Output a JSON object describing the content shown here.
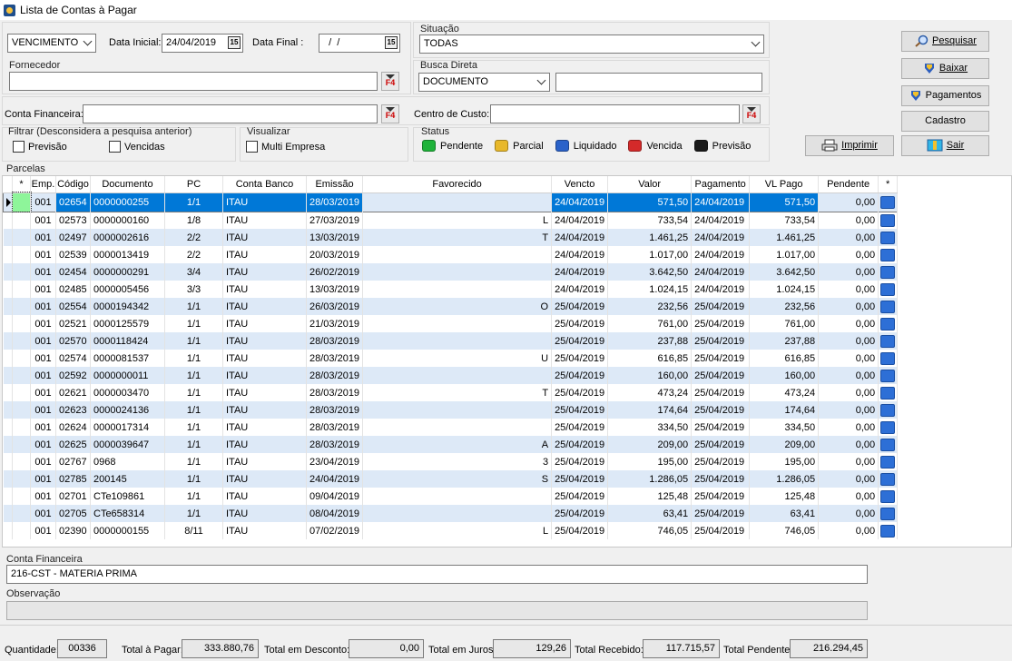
{
  "window": {
    "title": "Lista de Contas à Pagar"
  },
  "filters": {
    "date_type": "VENCIMENTO",
    "data_inicial_label": "Data Inicial:",
    "data_inicial": "24/04/2019",
    "data_final_label": "Data Final :",
    "data_final": "  /  /",
    "situacao_label": "Situação",
    "situacao": "TODAS",
    "fornecedor_label": "Fornecedor",
    "fornecedor": "",
    "busca_label": "Busca Direta",
    "busca_tipo": "DOCUMENTO",
    "busca_valor": "",
    "conta_financeira_label": "Conta Financeira:",
    "conta_financeira": "",
    "centro_custo_label": "Centro de Custo:",
    "centro_custo": "",
    "f4": "F4",
    "cal": "15",
    "filtrar_label": "Filtrar (Desconsidera a pesquisa anterior)",
    "previsao": "Previsão",
    "vencidas": "Vencidas",
    "visualizar_label": "Visualizar",
    "multi_empresa": "Multi Empresa"
  },
  "status": {
    "label": "Status",
    "items": [
      {
        "name": "Pendente",
        "color": "#1fb33a"
      },
      {
        "name": "Parcial",
        "color": "#e8b82a"
      },
      {
        "name": "Liquidado",
        "color": "#2a62c9"
      },
      {
        "name": "Vencida",
        "color": "#d42a2a"
      },
      {
        "name": "Previsão",
        "color": "#1a1a1a"
      }
    ]
  },
  "buttons": {
    "pesquisar": "Pesquisar",
    "baixar": "Baixar",
    "pagamentos": "Pagamentos",
    "cadastro": "Cadastro",
    "imprimir": "Imprimir",
    "sair": "Sair"
  },
  "grid": {
    "label": "Parcelas",
    "columns": [
      "*",
      "Emp.",
      "Código",
      "Documento",
      "PC",
      "Conta Banco",
      "Emissão",
      "Favorecido",
      "Vencto",
      "Valor",
      "Pagamento",
      "VL Pago",
      "Pendente",
      "*"
    ],
    "rows": [
      {
        "emp": "001",
        "cod": "02654",
        "doc": "0000000255",
        "pc": "1/1",
        "banco": "ITAU",
        "emissao": "28/03/2019",
        "fav": "",
        "vencto": "24/04/2019",
        "valor": "571,50",
        "pag": "24/04/2019",
        "vlpago": "571,50",
        "pend": "0,00"
      },
      {
        "emp": "001",
        "cod": "02573",
        "doc": "0000000160",
        "pc": "1/8",
        "banco": "ITAU",
        "emissao": "27/03/2019",
        "fav": "L",
        "vencto": "24/04/2019",
        "valor": "733,54",
        "pag": "24/04/2019",
        "vlpago": "733,54",
        "pend": "0,00"
      },
      {
        "emp": "001",
        "cod": "02497",
        "doc": "0000002616",
        "pc": "2/2",
        "banco": "ITAU",
        "emissao": "13/03/2019",
        "fav": "T",
        "vencto": "24/04/2019",
        "valor": "1.461,25",
        "pag": "24/04/2019",
        "vlpago": "1.461,25",
        "pend": "0,00"
      },
      {
        "emp": "001",
        "cod": "02539",
        "doc": "0000013419",
        "pc": "2/2",
        "banco": "ITAU",
        "emissao": "20/03/2019",
        "fav": "",
        "vencto": "24/04/2019",
        "valor": "1.017,00",
        "pag": "24/04/2019",
        "vlpago": "1.017,00",
        "pend": "0,00"
      },
      {
        "emp": "001",
        "cod": "02454",
        "doc": "0000000291",
        "pc": "3/4",
        "banco": "ITAU",
        "emissao": "26/02/2019",
        "fav": "",
        "vencto": "24/04/2019",
        "valor": "3.642,50",
        "pag": "24/04/2019",
        "vlpago": "3.642,50",
        "pend": "0,00"
      },
      {
        "emp": "001",
        "cod": "02485",
        "doc": "0000005456",
        "pc": "3/3",
        "banco": "ITAU",
        "emissao": "13/03/2019",
        "fav": "",
        "vencto": "24/04/2019",
        "valor": "1.024,15",
        "pag": "24/04/2019",
        "vlpago": "1.024,15",
        "pend": "0,00"
      },
      {
        "emp": "001",
        "cod": "02554",
        "doc": "0000194342",
        "pc": "1/1",
        "banco": "ITAU",
        "emissao": "26/03/2019",
        "fav": "O",
        "vencto": "25/04/2019",
        "valor": "232,56",
        "pag": "25/04/2019",
        "vlpago": "232,56",
        "pend": "0,00"
      },
      {
        "emp": "001",
        "cod": "02521",
        "doc": "0000125579",
        "pc": "1/1",
        "banco": "ITAU",
        "emissao": "21/03/2019",
        "fav": "",
        "vencto": "25/04/2019",
        "valor": "761,00",
        "pag": "25/04/2019",
        "vlpago": "761,00",
        "pend": "0,00"
      },
      {
        "emp": "001",
        "cod": "02570",
        "doc": "0000118424",
        "pc": "1/1",
        "banco": "ITAU",
        "emissao": "28/03/2019",
        "fav": "",
        "vencto": "25/04/2019",
        "valor": "237,88",
        "pag": "25/04/2019",
        "vlpago": "237,88",
        "pend": "0,00"
      },
      {
        "emp": "001",
        "cod": "02574",
        "doc": "0000081537",
        "pc": "1/1",
        "banco": "ITAU",
        "emissao": "28/03/2019",
        "fav": "U",
        "vencto": "25/04/2019",
        "valor": "616,85",
        "pag": "25/04/2019",
        "vlpago": "616,85",
        "pend": "0,00"
      },
      {
        "emp": "001",
        "cod": "02592",
        "doc": "0000000011",
        "pc": "1/1",
        "banco": "ITAU",
        "emissao": "28/03/2019",
        "fav": "",
        "vencto": "25/04/2019",
        "valor": "160,00",
        "pag": "25/04/2019",
        "vlpago": "160,00",
        "pend": "0,00"
      },
      {
        "emp": "001",
        "cod": "02621",
        "doc": "0000003470",
        "pc": "1/1",
        "banco": "ITAU",
        "emissao": "28/03/2019",
        "fav": "T",
        "vencto": "25/04/2019",
        "valor": "473,24",
        "pag": "25/04/2019",
        "vlpago": "473,24",
        "pend": "0,00"
      },
      {
        "emp": "001",
        "cod": "02623",
        "doc": "0000024136",
        "pc": "1/1",
        "banco": "ITAU",
        "emissao": "28/03/2019",
        "fav": "",
        "vencto": "25/04/2019",
        "valor": "174,64",
        "pag": "25/04/2019",
        "vlpago": "174,64",
        "pend": "0,00"
      },
      {
        "emp": "001",
        "cod": "02624",
        "doc": "0000017314",
        "pc": "1/1",
        "banco": "ITAU",
        "emissao": "28/03/2019",
        "fav": "",
        "vencto": "25/04/2019",
        "valor": "334,50",
        "pag": "25/04/2019",
        "vlpago": "334,50",
        "pend": "0,00"
      },
      {
        "emp": "001",
        "cod": "02625",
        "doc": "0000039647",
        "pc": "1/1",
        "banco": "ITAU",
        "emissao": "28/03/2019",
        "fav": "A",
        "vencto": "25/04/2019",
        "valor": "209,00",
        "pag": "25/04/2019",
        "vlpago": "209,00",
        "pend": "0,00"
      },
      {
        "emp": "001",
        "cod": "02767",
        "doc": "0968",
        "pc": "1/1",
        "banco": "ITAU",
        "emissao": "23/04/2019",
        "fav": "3",
        "vencto": "25/04/2019",
        "valor": "195,00",
        "pag": "25/04/2019",
        "vlpago": "195,00",
        "pend": "0,00"
      },
      {
        "emp": "001",
        "cod": "02785",
        "doc": "200145",
        "pc": "1/1",
        "banco": "ITAU",
        "emissao": "24/04/2019",
        "fav": "S",
        "vencto": "25/04/2019",
        "valor": "1.286,05",
        "pag": "25/04/2019",
        "vlpago": "1.286,05",
        "pend": "0,00"
      },
      {
        "emp": "001",
        "cod": "02701",
        "doc": "CTe109861",
        "pc": "1/1",
        "banco": "ITAU",
        "emissao": "09/04/2019",
        "fav": "",
        "vencto": "25/04/2019",
        "valor": "125,48",
        "pag": "25/04/2019",
        "vlpago": "125,48",
        "pend": "0,00"
      },
      {
        "emp": "001",
        "cod": "02705",
        "doc": "CTe658314",
        "pc": "1/1",
        "banco": "ITAU",
        "emissao": "08/04/2019",
        "fav": "",
        "vencto": "25/04/2019",
        "valor": "63,41",
        "pag": "25/04/2019",
        "vlpago": "63,41",
        "pend": "0,00"
      },
      {
        "emp": "001",
        "cod": "02390",
        "doc": "0000000155",
        "pc": "8/11",
        "banco": "ITAU",
        "emissao": "07/02/2019",
        "fav": "L",
        "vencto": "25/04/2019",
        "valor": "746,05",
        "pag": "25/04/2019",
        "vlpago": "746,05",
        "pend": "0,00"
      }
    ]
  },
  "detail": {
    "conta_label": "Conta Financeira",
    "conta_valor": "216-CST - MATERIA PRIMA",
    "obs_label": "Observação",
    "obs_valor": ""
  },
  "totals": {
    "quantidade_label": "Quantidade:",
    "quantidade": "00336",
    "total_pagar_label": "Total à Pagar:",
    "total_pagar": "333.880,76",
    "total_desconto_label": "Total em Desconto:",
    "total_desconto": "0,00",
    "total_juros_label": "Total em Juros:",
    "total_juros": "129,26",
    "total_recebido_label": "Total Recebido:",
    "total_recebido": "117.715,57",
    "total_pendente_label": "Total Pendente:",
    "total_pendente": "216.294,45"
  }
}
